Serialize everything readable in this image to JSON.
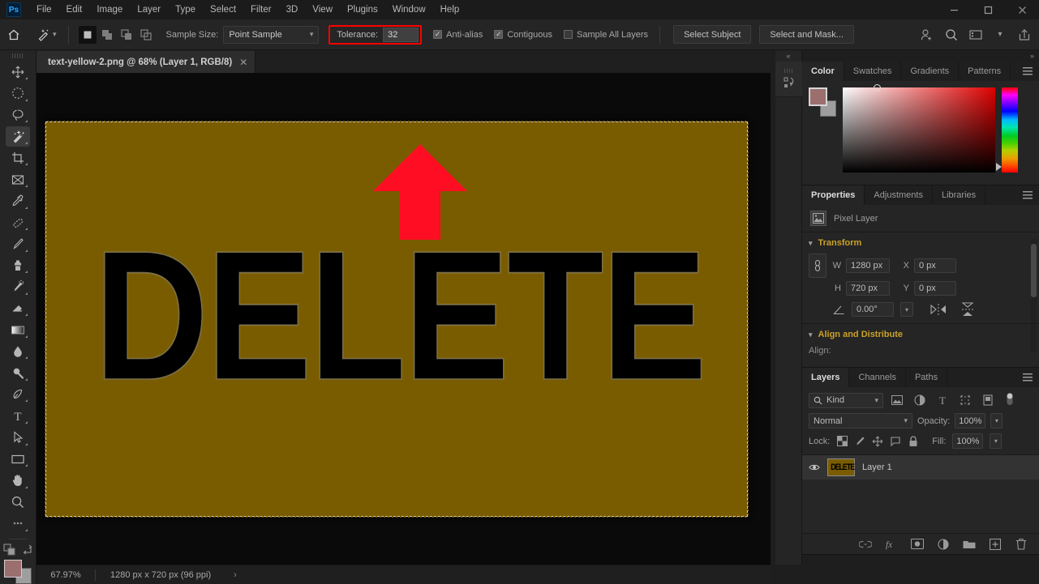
{
  "app": {
    "name": "Photoshop",
    "logo_text": "Ps"
  },
  "menubar": {
    "items": [
      "File",
      "Edit",
      "Image",
      "Layer",
      "Type",
      "Select",
      "Filter",
      "3D",
      "View",
      "Plugins",
      "Window",
      "Help"
    ]
  },
  "window_controls": {
    "minimize": "–",
    "maximize": "❐",
    "close": "✕"
  },
  "options_bar": {
    "home_icon": "home-icon",
    "tool_icon": "magic-wand-icon",
    "selection_modes": [
      "new-selection",
      "add-to-selection",
      "subtract-from-selection",
      "intersect-selection"
    ],
    "active_mode": "new-selection",
    "sample_size_label": "Sample Size:",
    "sample_size_value": "Point Sample",
    "tolerance_label": "Tolerance:",
    "tolerance_value": "32",
    "tolerance_highlight_color": "#ff0000",
    "anti_alias_label": "Anti-alias",
    "anti_alias_checked": true,
    "contiguous_label": "Contiguous",
    "contiguous_checked": true,
    "sample_all_layers_label": "Sample All Layers",
    "sample_all_layers_checked": false,
    "select_subject_label": "Select Subject",
    "select_and_mask_label": "Select and Mask...",
    "right_icons": [
      "share-user-icon",
      "search-icon",
      "workspace-icon",
      "chevron-down-icon",
      "export-icon"
    ]
  },
  "toolbar": {
    "tools": [
      {
        "name": "move-tool",
        "active": false
      },
      {
        "name": "elliptical-marquee-tool",
        "active": false
      },
      {
        "name": "lasso-tool",
        "active": false
      },
      {
        "name": "magic-wand-tool",
        "active": true
      },
      {
        "name": "crop-tool",
        "active": false
      },
      {
        "name": "frame-tool",
        "active": false
      },
      {
        "name": "eyedropper-tool",
        "active": false
      },
      {
        "name": "spot-healing-brush-tool",
        "active": false
      },
      {
        "name": "brush-tool",
        "active": false
      },
      {
        "name": "clone-stamp-tool",
        "active": false
      },
      {
        "name": "history-brush-tool",
        "active": false
      },
      {
        "name": "eraser-tool",
        "active": false
      },
      {
        "name": "gradient-tool",
        "active": false
      },
      {
        "name": "blur-tool",
        "active": false
      },
      {
        "name": "dodge-tool",
        "active": false
      },
      {
        "name": "pen-tool",
        "active": false
      },
      {
        "name": "type-tool",
        "active": false
      },
      {
        "name": "path-selection-tool",
        "active": false
      },
      {
        "name": "rectangle-tool",
        "active": false
      },
      {
        "name": "hand-tool",
        "active": false
      },
      {
        "name": "zoom-tool",
        "active": false
      },
      {
        "name": "edit-toolbar-tool",
        "active": false
      }
    ],
    "foreground_color": "#9c6f6f",
    "background_color": "#9e9e9e"
  },
  "document_tab": {
    "title": "text-yellow-2.png @ 68% (Layer 1, RGB/8)",
    "close_glyph": "✕"
  },
  "canvas": {
    "background_color": "#7a5c00",
    "artwork_text": "DELETE",
    "artwork_text_color": "#000000",
    "selection_active": true,
    "annotation": {
      "type": "arrow",
      "direction": "up",
      "color": "#ff0d22",
      "points_to": "tolerance-field"
    }
  },
  "collapsed_panels": {
    "collapse_glyph": "«",
    "buttons": [
      "history-actions-icon"
    ]
  },
  "color_panel": {
    "tabs": [
      "Color",
      "Swatches",
      "Gradients",
      "Patterns"
    ],
    "active_tab": "Color",
    "foreground_color": "#9c6f6f",
    "background_color": "#9e9e9e"
  },
  "properties_panel": {
    "tabs": [
      "Properties",
      "Adjustments",
      "Libraries"
    ],
    "active_tab": "Properties",
    "layer_kind": "Pixel Layer",
    "sections": {
      "transform": {
        "title": "Transform",
        "w_label": "W",
        "w_value": "1280 px",
        "h_label": "H",
        "h_value": "720 px",
        "x_label": "X",
        "x_value": "0 px",
        "y_label": "Y",
        "y_value": "0 px",
        "angle_value": "0.00°",
        "flip_horizontal": "flip-horizontal-icon",
        "flip_vertical": "flip-vertical-icon"
      },
      "align": {
        "title": "Align and Distribute",
        "align_label": "Align:"
      }
    }
  },
  "layers_panel": {
    "tabs": [
      "Layers",
      "Channels",
      "Paths"
    ],
    "active_tab": "Layers",
    "filter_kind": "Kind",
    "filter_icons": [
      "pixel-filter-icon",
      "adjustment-filter-icon",
      "type-filter-icon",
      "shape-filter-icon",
      "smart-object-filter-icon"
    ],
    "filter_toggle": "filter-toggle-icon",
    "blend_mode": "Normal",
    "opacity_label": "Opacity:",
    "opacity_value": "100%",
    "lock_label": "Lock:",
    "lock_icons": [
      "lock-transparent-pixels-icon",
      "lock-image-pixels-icon",
      "lock-position-icon",
      "lock-artboard-icon",
      "lock-all-icon"
    ],
    "fill_label": "Fill:",
    "fill_value": "100%",
    "layers": [
      {
        "name": "Layer 1",
        "visible": true,
        "selected": true,
        "thumbnail_text": "DELETE",
        "thumbnail_bg": "#7a5c00"
      }
    ],
    "footer_icons": [
      "link-layers-icon",
      "layer-style-fx-icon",
      "layer-mask-icon",
      "adjustment-layer-icon",
      "new-group-icon",
      "new-layer-icon",
      "delete-layer-icon"
    ]
  },
  "status_bar": {
    "zoom": "67.97%",
    "dimensions": "1280 px x 720 px (96 ppi)",
    "expand_glyph": "›"
  }
}
